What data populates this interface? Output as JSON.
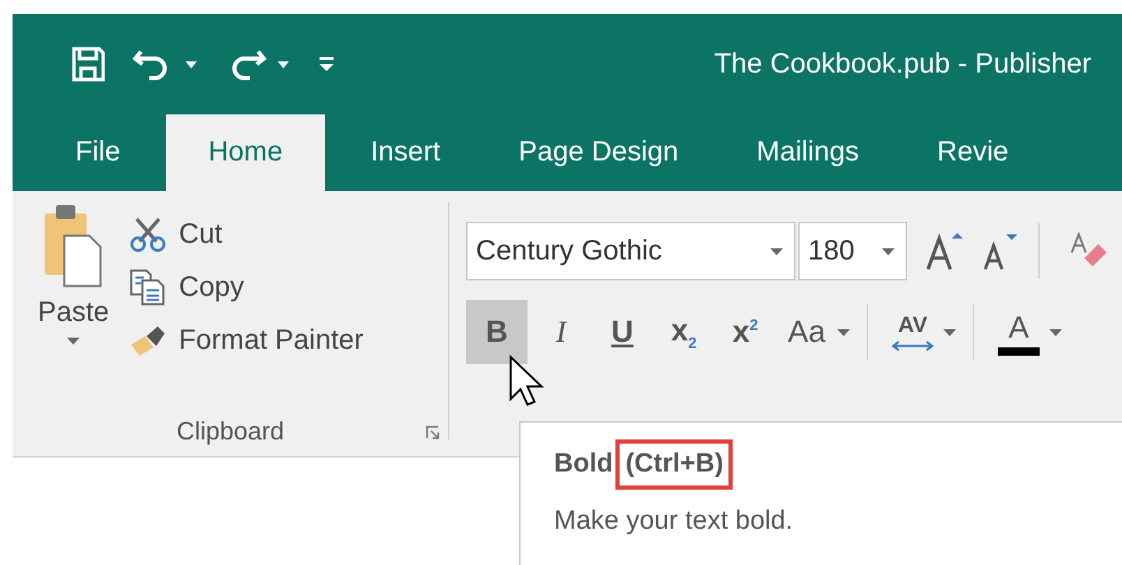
{
  "window": {
    "title": "The Cookbook.pub - Publisher"
  },
  "quick_access": [
    {
      "kind": "save",
      "dropdown": false
    },
    {
      "kind": "undo",
      "dropdown": true
    },
    {
      "kind": "redo",
      "dropdown": true
    },
    {
      "kind": "customize",
      "dropdown": false
    }
  ],
  "tabs": [
    {
      "label": "File",
      "selected": false
    },
    {
      "label": "Home",
      "selected": true
    },
    {
      "label": "Insert",
      "selected": false
    },
    {
      "label": "Page Design",
      "selected": false
    },
    {
      "label": "Mailings",
      "selected": false
    },
    {
      "label": "Revie",
      "selected": false
    }
  ],
  "clipboard": {
    "paste": "Paste",
    "group_label": "Clipboard",
    "commands": [
      {
        "kind": "cut",
        "label": "Cut"
      },
      {
        "kind": "copy",
        "label": "Copy"
      },
      {
        "kind": "format_painter",
        "label": "Format Painter"
      }
    ]
  },
  "font": {
    "font_name": "Century Gothic",
    "font_size": "180",
    "format_buttons": [
      {
        "kind": "bold",
        "label": "B",
        "selected": true,
        "dropdown": false
      },
      {
        "kind": "italic",
        "label": "I",
        "selected": false,
        "dropdown": false
      },
      {
        "kind": "underline",
        "label": "U",
        "selected": false,
        "dropdown": false
      },
      {
        "kind": "subscript",
        "label": "x$_{2}$",
        "selected": false,
        "dropdown": false
      },
      {
        "kind": "superscript",
        "label": "x$^{2}$",
        "selected": false,
        "dropdown": false
      },
      {
        "kind": "case",
        "label": "Aa",
        "selected": false,
        "dropdown": true
      },
      {
        "kind": "spacing",
        "label": "AV",
        "selected": false,
        "dropdown": true
      },
      {
        "kind": "color",
        "label": "A",
        "selected": false,
        "dropdown": true
      }
    ]
  },
  "tooltip": {
    "title": "Bold",
    "shortcut": "(Ctrl+B)",
    "shortcut_highlighted": true,
    "description": "Make your text bold."
  }
}
